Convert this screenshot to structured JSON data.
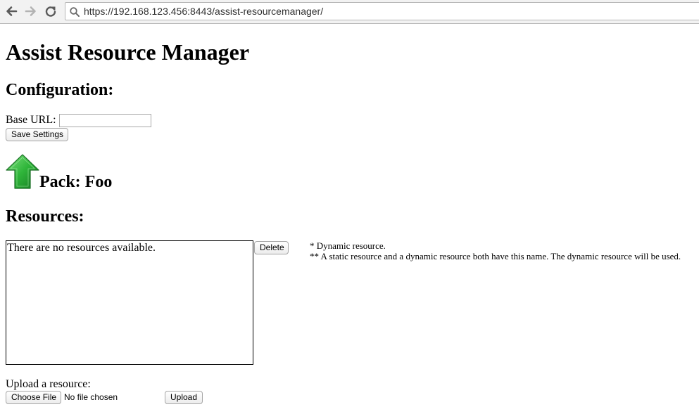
{
  "browser": {
    "url": "https://192.168.123.456:8443/assist-resourcemanager/"
  },
  "page": {
    "title": "Assist Resource Manager",
    "configuration": {
      "heading": "Configuration:",
      "base_url_label": "Base URL:",
      "base_url_value": "",
      "save_label": "Save Settings"
    },
    "pack": {
      "heading": "Pack: Foo",
      "icon": "green-up-arrow-icon"
    },
    "resources": {
      "heading": "Resources:",
      "empty_message": "There are no resources available.",
      "delete_label": "Delete",
      "notes": [
        "* Dynamic resource.",
        "** A static resource and a dynamic resource both have this name. The dynamic resource will be used."
      ]
    },
    "upload": {
      "label": "Upload a resource:",
      "choose_label": "Choose File",
      "no_file_text": "No file chosen",
      "upload_label": "Upload"
    }
  }
}
